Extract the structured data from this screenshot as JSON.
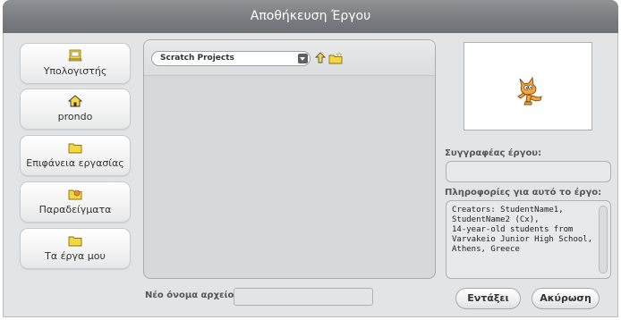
{
  "dialog": {
    "title": "Αποθήκευση Έργου"
  },
  "places": [
    {
      "label": "Υπολογιστής",
      "icon": "computer-icon"
    },
    {
      "label": "prondo",
      "icon": "home-icon"
    },
    {
      "label": "Επιφάνεια εργασίας",
      "icon": "folder-icon"
    },
    {
      "label": "Παραδείγματα",
      "icon": "examples-folder-icon"
    },
    {
      "label": "Τα έργα μου",
      "icon": "folder-icon"
    }
  ],
  "browser": {
    "folder": "Scratch Projects",
    "up_icon": "up-arrow-icon",
    "new_folder_icon": "new-folder-icon"
  },
  "project": {
    "author_label": "Συγγραφέας έργου:",
    "author": "",
    "notes_label": "Πληροφορίες για αυτό το έργο:",
    "notes": "Creators: StudentName1,\nStudentName2 (Cx),\n14-year-old students from\nVarvakeio Junior High School,\nAthens, Greece"
  },
  "footer": {
    "filename_label": "Νέο όνομα αρχείου:",
    "filename": "",
    "ok_label": "Εντάξει",
    "cancel_label": "Ακύρωση"
  },
  "colors": {
    "title_bar": "#797d81",
    "panel_bg": "#e3e4e5",
    "folder_yellow": "#f5d742"
  }
}
